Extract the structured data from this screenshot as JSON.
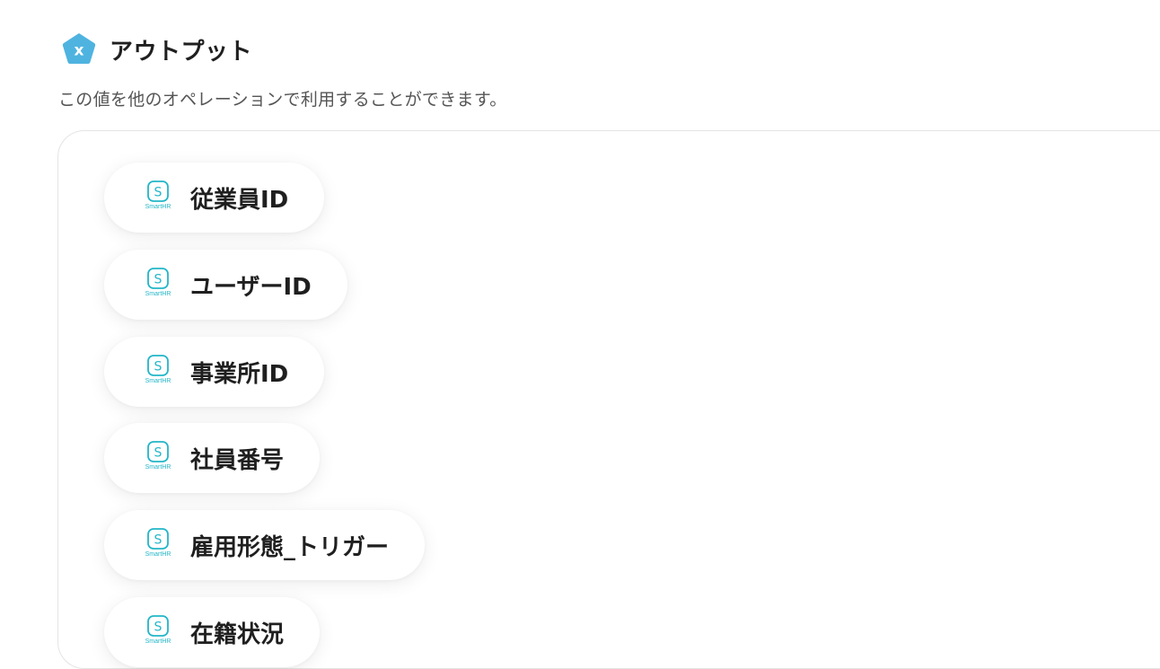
{
  "header": {
    "title": "アウトプット",
    "icon": "x-pentagon-icon",
    "icon_color": "#4fb3e0"
  },
  "subtitle": "この値を他のオペレーションで利用することができます。",
  "outputs": [
    {
      "label": "従業員ID",
      "app": "SmartHR"
    },
    {
      "label": "ユーザーID",
      "app": "SmartHR"
    },
    {
      "label": "事業所ID",
      "app": "SmartHR"
    },
    {
      "label": "社員番号",
      "app": "SmartHR"
    },
    {
      "label": "雇用形態_トリガー",
      "app": "SmartHR"
    },
    {
      "label": "在籍状況",
      "app": "SmartHR"
    }
  ],
  "colors": {
    "smarthr_accent": "#23b6c8",
    "panel_border": "#e4e4e4"
  }
}
